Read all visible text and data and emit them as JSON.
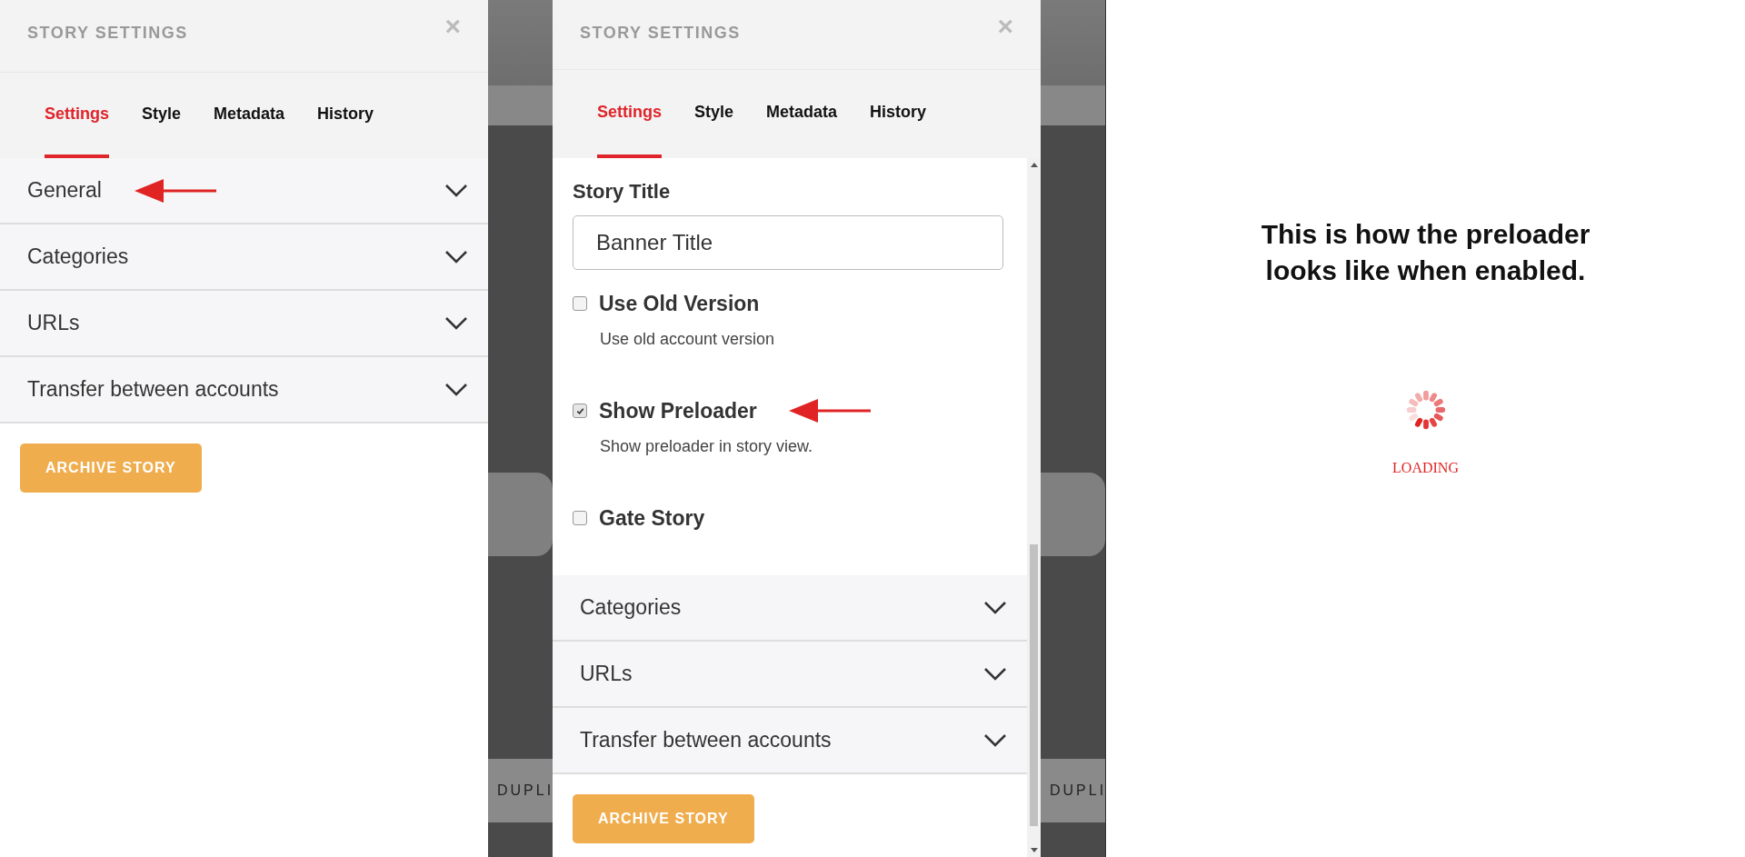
{
  "panels": [
    {
      "title": "STORY SETTINGS",
      "close": "×",
      "tabs": [
        {
          "label": "Settings",
          "selected": true
        },
        {
          "label": "Style",
          "selected": false
        },
        {
          "label": "Metadata",
          "selected": false
        },
        {
          "label": "History",
          "selected": false
        }
      ],
      "sections": [
        {
          "label": "General",
          "arrow": true
        },
        {
          "label": "Categories",
          "arrow": false
        },
        {
          "label": "URLs",
          "arrow": false
        },
        {
          "label": "Transfer between accounts",
          "arrow": false
        }
      ],
      "archive_button": "ARCHIVE STORY"
    },
    {
      "title": "STORY SETTINGS",
      "close": "×",
      "tabs": [
        {
          "label": "Settings",
          "selected": true
        },
        {
          "label": "Style",
          "selected": false
        },
        {
          "label": "Metadata",
          "selected": false
        },
        {
          "label": "History",
          "selected": false
        }
      ],
      "general": {
        "title_label": "Story Title",
        "title_value": "Banner Title",
        "options": [
          {
            "label": "Use Old Version",
            "description": "Use old account version",
            "checked": false,
            "arrow": false
          },
          {
            "label": "Show Preloader",
            "description": "Show preloader in story view.",
            "checked": true,
            "arrow": true
          },
          {
            "label": "Gate Story",
            "checked": false,
            "arrow": false
          }
        ]
      },
      "sections": [
        {
          "label": "Categories",
          "arrow": false
        },
        {
          "label": "URLs",
          "arrow": false
        },
        {
          "label": "Transfer between accounts",
          "arrow": false
        }
      ],
      "archive_button": "ARCHIVE STORY"
    }
  ],
  "background_buttons": [
    "DUPLI",
    "DUPLI"
  ],
  "preview": {
    "message": "This is how the preloader looks like when enabled.",
    "loading_text": "LOADING"
  }
}
